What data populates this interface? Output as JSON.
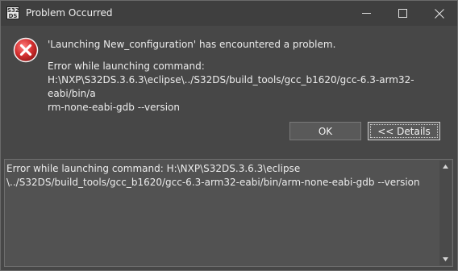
{
  "window": {
    "title": "Problem Occurred",
    "app_icon_text": "S32\nDS",
    "controls": {
      "minimize": "minimize-icon",
      "maximize": "maximize-icon",
      "close": "close-icon"
    }
  },
  "message": {
    "icon": "error-icon",
    "headline": "'Launching New_configuration' has encountered a problem.",
    "detail_line1": "Error while launching command:",
    "detail_line2": "H:\\NXP\\S32DS.3.6.3\\eclipse\\../S32DS/build_tools/gcc_b1620/gcc-6.3-arm32-eabi/bin/a",
    "detail_line3": "rm-none-eabi-gdb --version"
  },
  "buttons": {
    "ok": "OK",
    "details": "<< Details"
  },
  "details": {
    "text": "Error while launching command: H:\\NXP\\S32DS.3.6.3\\eclipse\n\\../S32DS/build_tools/gcc_b1620/gcc-6.3-arm32-eabi/bin/arm-none-eabi-gdb --version"
  },
  "colors": {
    "error_red": "#d32f2f",
    "background": "#474747",
    "text": "#ececec"
  }
}
